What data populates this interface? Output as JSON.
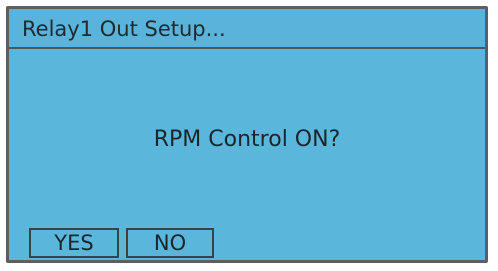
{
  "screen": {
    "title": "Relay1 Out Setup...",
    "prompt": "RPM Control ON?",
    "buttons": {
      "yes_label": "YES",
      "no_label": "NO"
    }
  },
  "colors": {
    "lcd_background": "#5bb6dc",
    "frame_border": "#5a5f63",
    "text": "#1c252b"
  }
}
